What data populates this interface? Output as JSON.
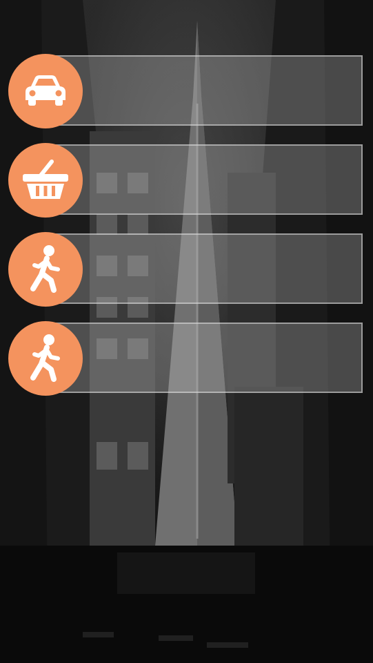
{
  "theme": {
    "accent": "#f4935e",
    "panel_fill": "rgba(190,190,190,0.32)",
    "panel_border": "rgba(225,225,225,0.55)",
    "background": "#1a1a1a"
  },
  "menu": {
    "items": [
      {
        "icon": "car-icon",
        "label": ""
      },
      {
        "icon": "shopping-basket-icon",
        "label": ""
      },
      {
        "icon": "walking-person-icon",
        "label": ""
      },
      {
        "icon": "walking-person-icon",
        "label": ""
      }
    ]
  }
}
